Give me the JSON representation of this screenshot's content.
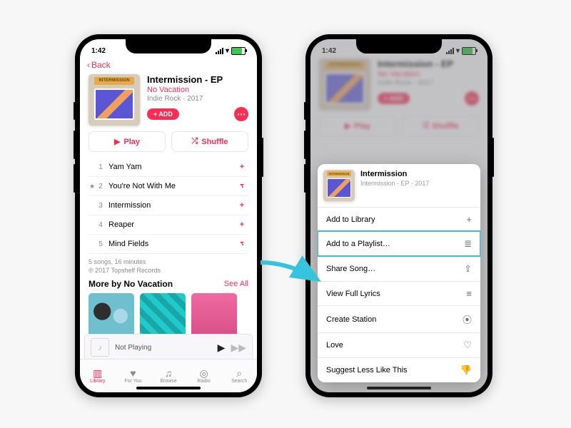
{
  "status": {
    "time": "1:42",
    "carrier": "▸"
  },
  "nav": {
    "back": "Back"
  },
  "album": {
    "title": "Intermission - EP",
    "artist": "No Vacation",
    "genre": "Indie Rock · 2017",
    "cover_sign": "INTERMISSION"
  },
  "buttons": {
    "add": "+ ADD",
    "play": "Play",
    "shuffle": "Shuffle"
  },
  "tracks": [
    {
      "n": "1",
      "name": "Yam Yam",
      "act": "plus"
    },
    {
      "n": "2",
      "name": "You're Not With Me",
      "act": "cloud",
      "star": true
    },
    {
      "n": "3",
      "name": "Intermission",
      "act": "plus"
    },
    {
      "n": "4",
      "name": "Reaper",
      "act": "plus"
    },
    {
      "n": "5",
      "name": "Mind Fields",
      "act": "cloud"
    }
  ],
  "summary": {
    "line1": "5 songs, 16 minutes",
    "line2": "℗ 2017 Topshelf Records"
  },
  "more": {
    "heading": "More by No Vacation",
    "seeall": "See All"
  },
  "nowplaying": {
    "label": "Not Playing"
  },
  "tabs": [
    {
      "label": "Library",
      "icon": "▥"
    },
    {
      "label": "For You",
      "icon": "♥"
    },
    {
      "label": "Browse",
      "icon": "♫"
    },
    {
      "label": "Radio",
      "icon": "◎"
    },
    {
      "label": "Search",
      "icon": "⌕"
    }
  ],
  "sheet": {
    "title": "Intermission",
    "sub": "Intermission - EP · 2017",
    "items": [
      {
        "label": "Add to Library",
        "icon": "+"
      },
      {
        "label": "Add to a Playlist…",
        "icon": "≣",
        "hl": true
      },
      {
        "label": "Share Song…",
        "icon": "⇪"
      },
      {
        "label": "View Full Lyrics",
        "icon": "≡"
      },
      {
        "label": "Create Station",
        "icon": "⦿"
      },
      {
        "label": "Love",
        "icon": "♡"
      },
      {
        "label": "Suggest Less Like This",
        "icon": "👎"
      }
    ]
  }
}
